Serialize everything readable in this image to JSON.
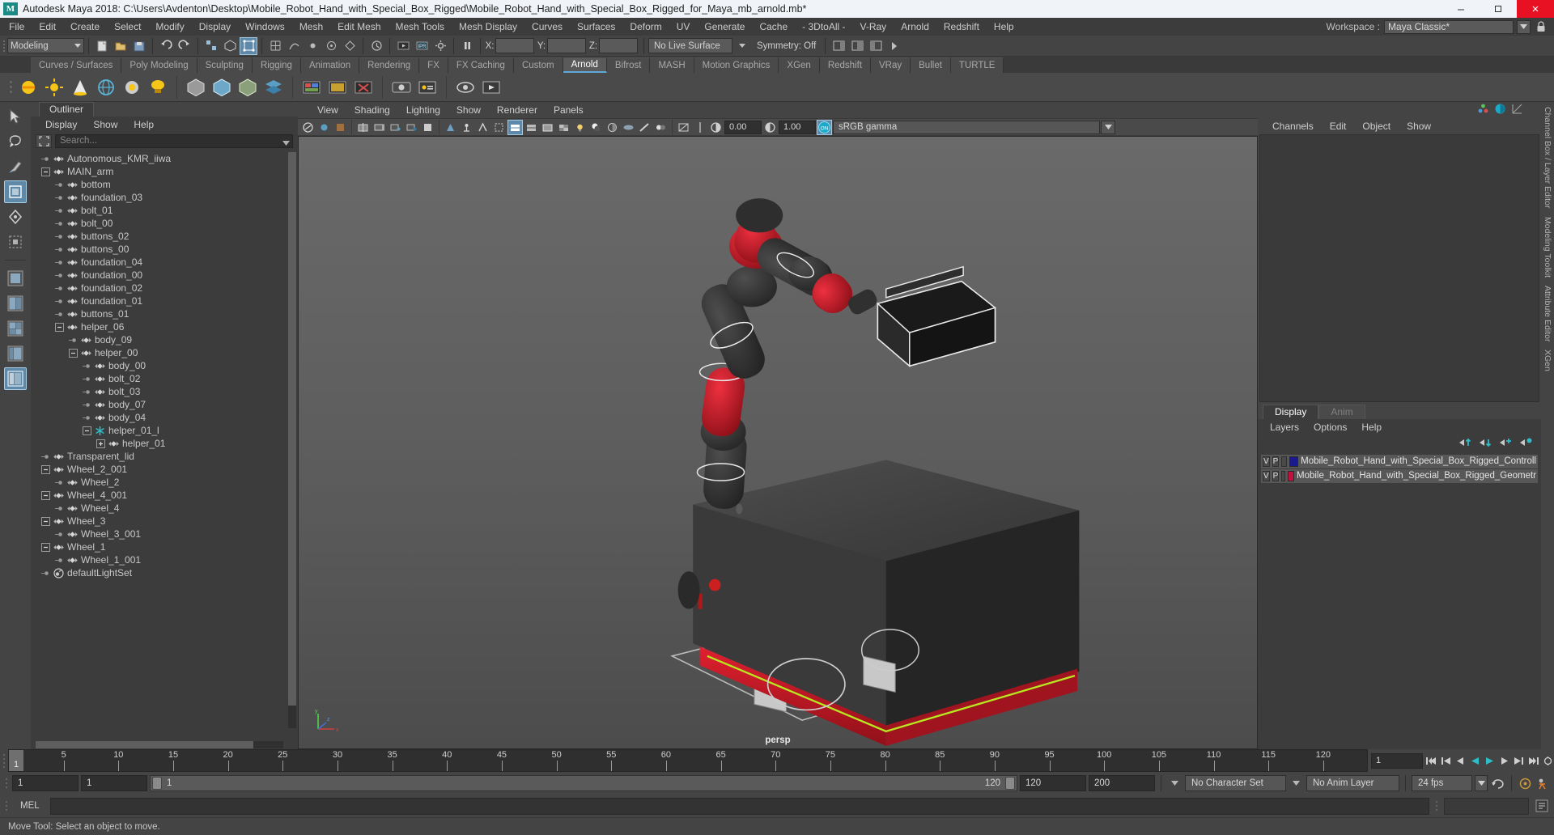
{
  "titlebar": {
    "app_title": "Autodesk Maya 2018: C:\\Users\\Avdenton\\Desktop\\Mobile_Robot_Hand_with_Special_Box_Rigged\\Mobile_Robot_Hand_with_Special_Box_Rigged_for_Maya_mb_arnold.mb*",
    "logo": "M",
    "minimize": "–",
    "maximize": "❐",
    "close": "✕"
  },
  "menubar": {
    "items": [
      "File",
      "Edit",
      "Create",
      "Select",
      "Modify",
      "Display",
      "Windows",
      "Mesh",
      "Edit Mesh",
      "Mesh Tools",
      "Mesh Display",
      "Curves",
      "Surfaces",
      "Deform",
      "UV",
      "Generate",
      "Cache",
      "- 3DtoAll -",
      "V-Ray",
      "Arnold",
      "Redshift",
      "Help"
    ],
    "workspace_label": "Workspace :",
    "workspace_value": "Maya Classic*"
  },
  "statusline": {
    "mode": "Modeling",
    "no_live_surface": "No Live Surface",
    "symmetry": "Symmetry: Off",
    "coord_x": "X:",
    "coord_y": "Y:",
    "coord_z": "Z:"
  },
  "shelf": {
    "tabs": [
      "Curves / Surfaces",
      "Poly Modeling",
      "Sculpting",
      "Rigging",
      "Animation",
      "Rendering",
      "FX",
      "FX Caching",
      "Custom",
      "Arnold",
      "Bifrost",
      "MASH",
      "Motion Graphics",
      "XGen",
      "Redshift",
      "VRay",
      "Bullet",
      "TURTLE"
    ],
    "active_tab": "Arnold"
  },
  "outliner": {
    "tab": "Outliner",
    "menu": [
      "Display",
      "Show",
      "Help"
    ],
    "search_placeholder": "Search...",
    "tree": [
      {
        "label": "Autonomous_KMR_iiwa",
        "depth": 1,
        "expander": "none",
        "icon": "transform-icon"
      },
      {
        "label": "MAIN_arm",
        "depth": 1,
        "expander": "minus",
        "icon": "transform-icon"
      },
      {
        "label": "bottom",
        "depth": 2,
        "expander": "none",
        "icon": "transform-icon"
      },
      {
        "label": "foundation_03",
        "depth": 2,
        "expander": "none",
        "icon": "transform-icon"
      },
      {
        "label": "bolt_01",
        "depth": 2,
        "expander": "none",
        "icon": "transform-icon"
      },
      {
        "label": "bolt_00",
        "depth": 2,
        "expander": "none",
        "icon": "transform-icon"
      },
      {
        "label": "buttons_02",
        "depth": 2,
        "expander": "none",
        "icon": "transform-icon"
      },
      {
        "label": "buttons_00",
        "depth": 2,
        "expander": "none",
        "icon": "transform-icon"
      },
      {
        "label": "foundation_04",
        "depth": 2,
        "expander": "none",
        "icon": "transform-icon"
      },
      {
        "label": "foundation_00",
        "depth": 2,
        "expander": "none",
        "icon": "transform-icon"
      },
      {
        "label": "foundation_02",
        "depth": 2,
        "expander": "none",
        "icon": "transform-icon"
      },
      {
        "label": "foundation_01",
        "depth": 2,
        "expander": "none",
        "icon": "transform-icon"
      },
      {
        "label": "buttons_01",
        "depth": 2,
        "expander": "none",
        "icon": "transform-icon"
      },
      {
        "label": "helper_06",
        "depth": 2,
        "expander": "minus",
        "icon": "transform-icon"
      },
      {
        "label": "body_09",
        "depth": 3,
        "expander": "none",
        "icon": "transform-icon"
      },
      {
        "label": "helper_00",
        "depth": 3,
        "expander": "minus",
        "icon": "transform-icon"
      },
      {
        "label": "body_00",
        "depth": 4,
        "expander": "none",
        "icon": "transform-icon"
      },
      {
        "label": "bolt_02",
        "depth": 4,
        "expander": "none",
        "icon": "transform-icon"
      },
      {
        "label": "bolt_03",
        "depth": 4,
        "expander": "none",
        "icon": "transform-icon"
      },
      {
        "label": "body_07",
        "depth": 4,
        "expander": "none",
        "icon": "transform-icon"
      },
      {
        "label": "body_04",
        "depth": 4,
        "expander": "none",
        "icon": "transform-icon"
      },
      {
        "label": "helper_01_l",
        "depth": 4,
        "expander": "minus",
        "icon": "joint-icon"
      },
      {
        "label": "helper_01",
        "depth": 5,
        "expander": "plus",
        "icon": "transform-icon"
      },
      {
        "label": "Transparent_lid",
        "depth": 1,
        "expander": "none",
        "icon": "transform-icon"
      },
      {
        "label": "Wheel_2_001",
        "depth": 1,
        "expander": "minus",
        "icon": "transform-icon"
      },
      {
        "label": "Wheel_2",
        "depth": 2,
        "expander": "none",
        "icon": "transform-icon"
      },
      {
        "label": "Wheel_4_001",
        "depth": 1,
        "expander": "minus",
        "icon": "transform-icon"
      },
      {
        "label": "Wheel_4",
        "depth": 2,
        "expander": "none",
        "icon": "transform-icon"
      },
      {
        "label": "Wheel_3",
        "depth": 1,
        "expander": "minus",
        "icon": "transform-icon"
      },
      {
        "label": "Wheel_3_001",
        "depth": 2,
        "expander": "none",
        "icon": "transform-icon"
      },
      {
        "label": "Wheel_1",
        "depth": 1,
        "expander": "minus",
        "icon": "transform-icon"
      },
      {
        "label": "Wheel_1_001",
        "depth": 2,
        "expander": "none",
        "icon": "transform-icon"
      },
      {
        "label": "defaultLightSet",
        "depth": 1,
        "expander": "none",
        "icon": "lightset-icon"
      }
    ]
  },
  "viewport": {
    "menu": [
      "View",
      "Shading",
      "Lighting",
      "Show",
      "Renderer",
      "Panels"
    ],
    "exposure_value": "0.00",
    "gamma_value": "1.00",
    "color_management": "sRGB gamma",
    "camera_label": "persp"
  },
  "channelbox": {
    "menu": [
      "Channels",
      "Edit",
      "Object",
      "Show"
    ],
    "dock_labels": [
      "Channel Box / Layer Editor",
      "Modeling Toolkit",
      "Attribute Editor",
      "XGen"
    ]
  },
  "layers": {
    "tabs": [
      "Display",
      "Anim"
    ],
    "active_tab": "Display",
    "menu": [
      "Layers",
      "Options",
      "Help"
    ],
    "rows": [
      {
        "v": "V",
        "p": "P",
        "color": "#1a1a8c",
        "name": "Mobile_Robot_Hand_with_Special_Box_Rigged_Controll"
      },
      {
        "v": "V",
        "p": "P",
        "color": "#c01040",
        "name": "Mobile_Robot_Hand_with_Special_Box_Rigged_Geometr"
      }
    ]
  },
  "timeline": {
    "current_frame": "1",
    "ticks": [
      5,
      10,
      15,
      20,
      25,
      30,
      35,
      40,
      45,
      50,
      55,
      60,
      65,
      70,
      75,
      80,
      85,
      90,
      95,
      100,
      105,
      110,
      115,
      120
    ],
    "frame_field": "1",
    "playback_start": "1",
    "range_start": "1",
    "range_end": "120",
    "anim_end": "120",
    "total_end": "200",
    "character_set": "No Character Set",
    "anim_layer": "No Anim Layer",
    "fps": "24 fps"
  },
  "command": {
    "language": "MEL",
    "input_value": "",
    "status": "Move Tool: Select an object to move."
  }
}
